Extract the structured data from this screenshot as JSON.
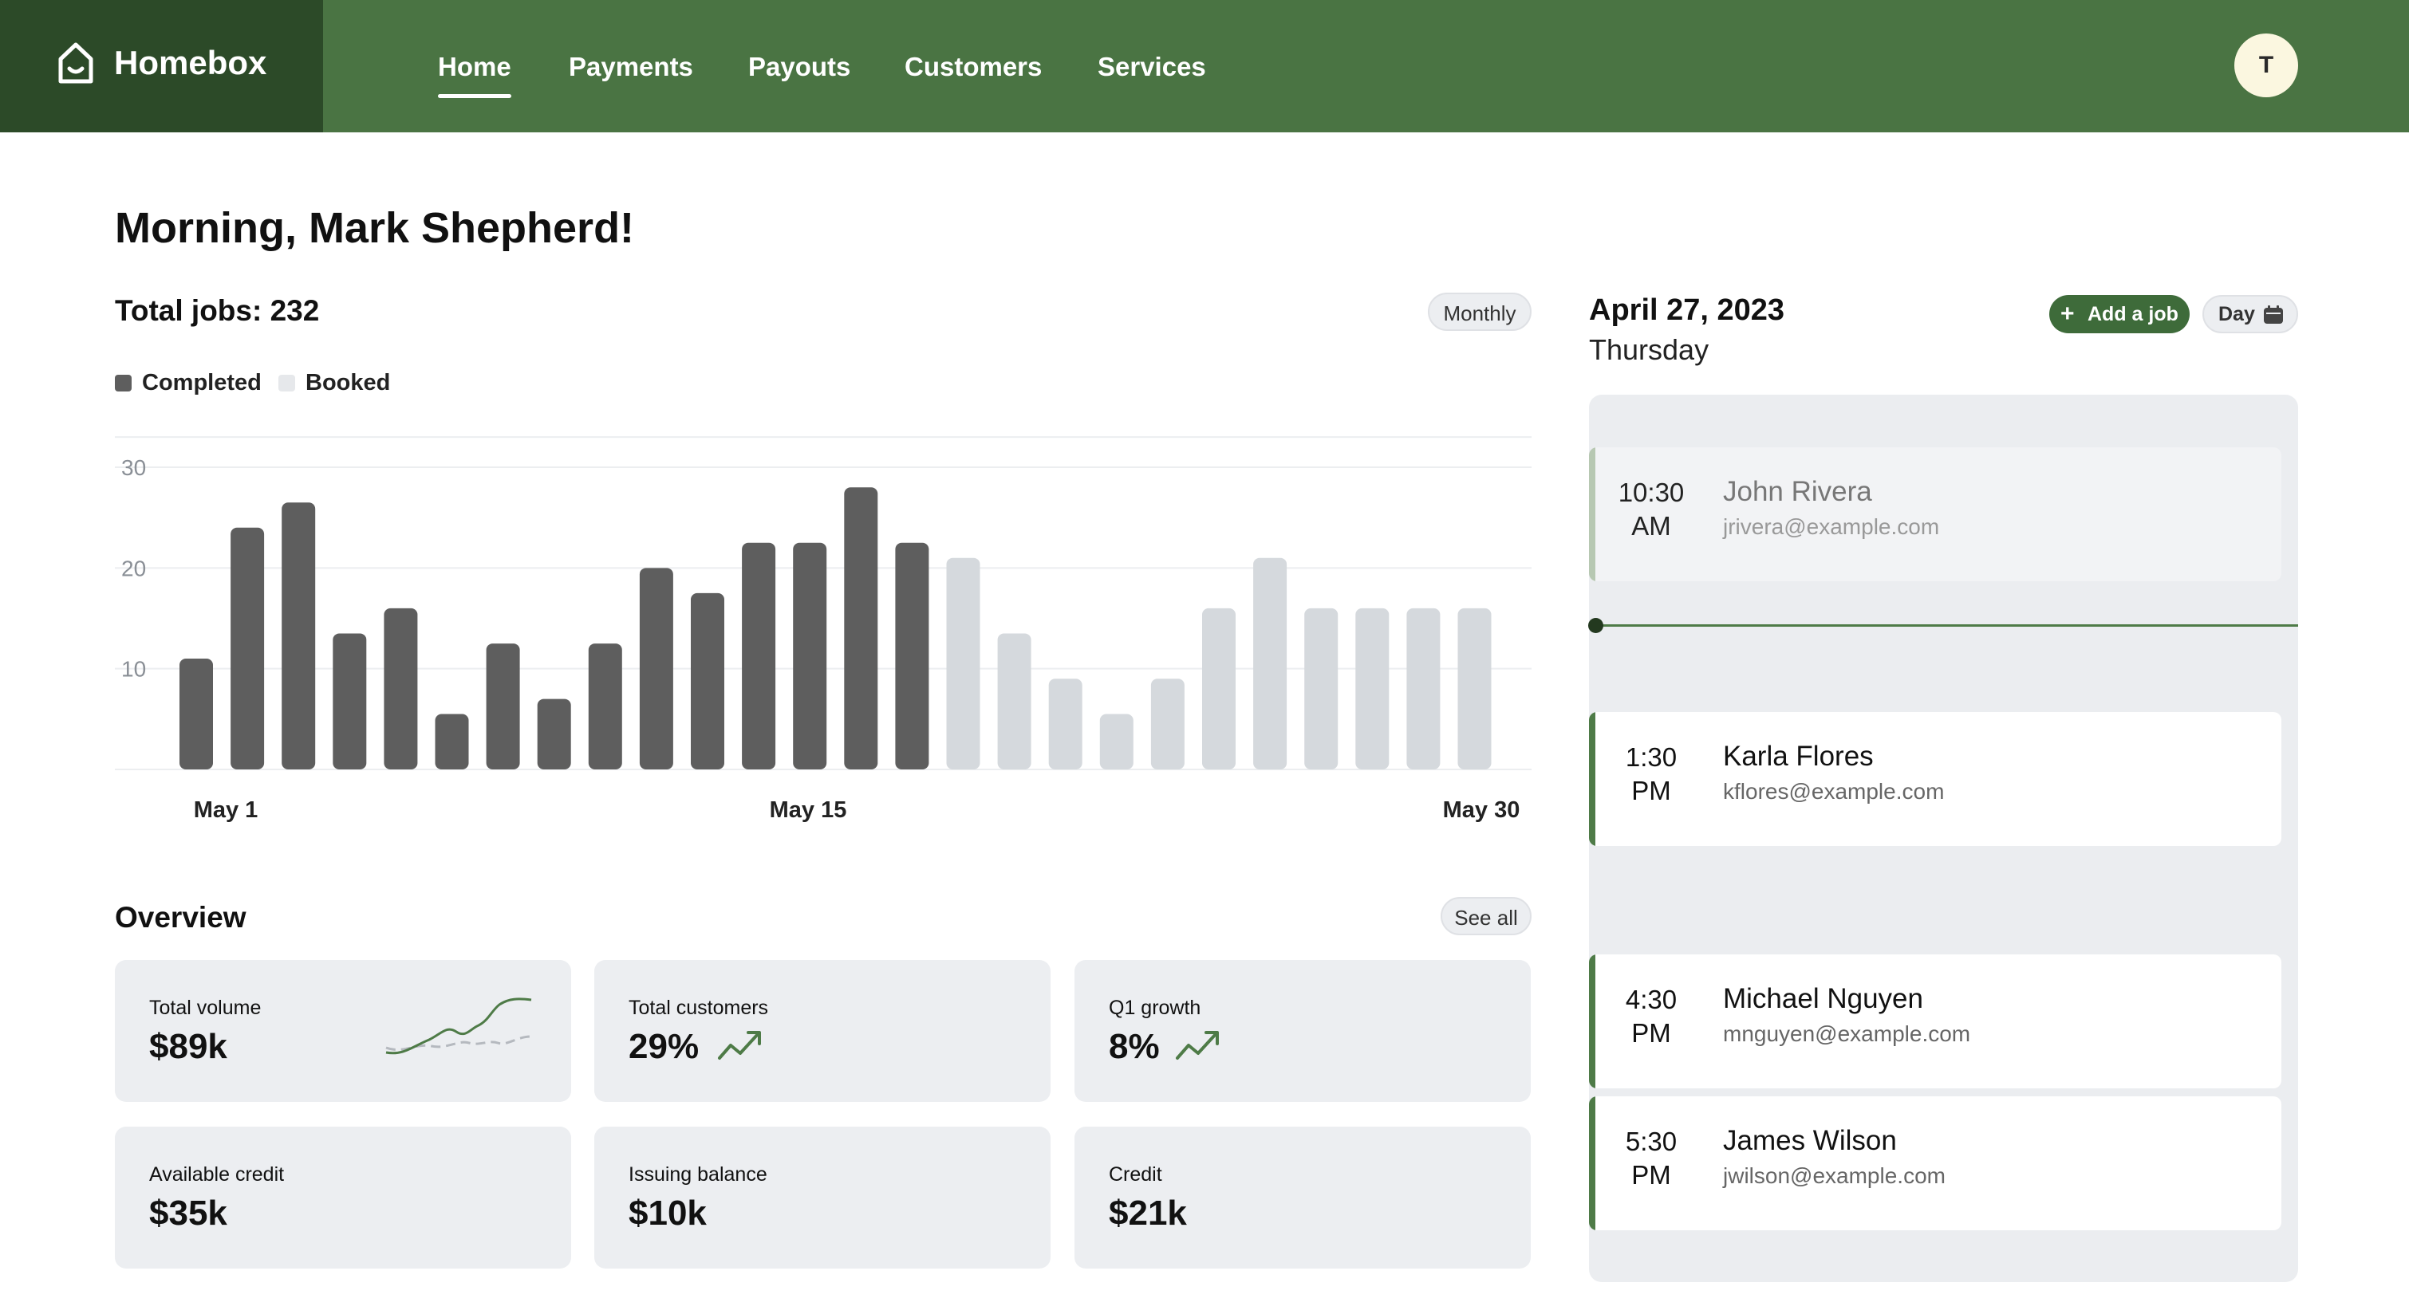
{
  "app": {
    "name": "Homebox",
    "logo_icon": "house-icon"
  },
  "nav": {
    "items": [
      {
        "label": "Home",
        "active": true
      },
      {
        "label": "Payments"
      },
      {
        "label": "Payouts"
      },
      {
        "label": "Customers"
      },
      {
        "label": "Services"
      }
    ]
  },
  "user": {
    "avatar_initial": "T"
  },
  "greeting": "Morning, Mark Shepherd!",
  "jobs": {
    "total_label": "Total jobs: 232",
    "period_button": "Monthly",
    "legend": [
      {
        "label": "Completed",
        "color": "#5e5e5e"
      },
      {
        "label": "Booked",
        "color": "#d5d9dd"
      }
    ]
  },
  "chart_data": {
    "type": "bar",
    "title": "",
    "ylim": [
      0,
      33
    ],
    "y_ticks": [
      10,
      20,
      30
    ],
    "x_tick_labels": [
      "May 1",
      "May 15",
      "May 30"
    ],
    "grid": true,
    "legend_position": "top-left",
    "series": [
      {
        "name": "Completed",
        "color": "#5e5e5e",
        "values": [
          11,
          24,
          26.5,
          13.5,
          16,
          5.5,
          12.5,
          7,
          12.5,
          20,
          17.5,
          22.5,
          22.5,
          28,
          22.5,
          null,
          null,
          null,
          null,
          null,
          null,
          null,
          null,
          null,
          null,
          null
        ]
      },
      {
        "name": "Booked",
        "color": "#d5d9dd",
        "values": [
          null,
          null,
          null,
          null,
          null,
          null,
          null,
          null,
          null,
          null,
          null,
          null,
          null,
          null,
          null,
          21,
          13.5,
          9,
          5.5,
          9,
          16,
          21,
          16,
          16,
          16,
          16
        ]
      }
    ]
  },
  "overview": {
    "title": "Overview",
    "see_all": "See all",
    "cards": [
      {
        "label": "Total volume",
        "value": "$89k",
        "icon": "sparkline"
      },
      {
        "label": "Total customers",
        "value": "29%",
        "icon": "trend-up-icon"
      },
      {
        "label": "Q1 growth",
        "value": "8%",
        "icon": "trend-up-icon"
      },
      {
        "label": "Available credit",
        "value": "$35k"
      },
      {
        "label": "Issuing balance",
        "value": "$10k"
      },
      {
        "label": "Credit",
        "value": "$21k"
      }
    ]
  },
  "schedule": {
    "date": "April 27, 2023",
    "weekday": "Thursday",
    "add_button": "Add a job",
    "view_button": "Day",
    "accent": "#4e7b47",
    "appointments": [
      {
        "time": "10:30",
        "period": "AM",
        "name": "John Rivera",
        "email": "jrivera@example.com",
        "past": true
      },
      {
        "time": "1:30",
        "period": "PM",
        "name": "Karla Flores",
        "email": "kflores@example.com"
      },
      {
        "time": "4:30",
        "period": "PM",
        "name": "Michael Nguyen",
        "email": "mnguyen@example.com"
      },
      {
        "time": "5:30",
        "period": "PM",
        "name": "James Wilson",
        "email": "jwilson@example.com"
      }
    ]
  }
}
